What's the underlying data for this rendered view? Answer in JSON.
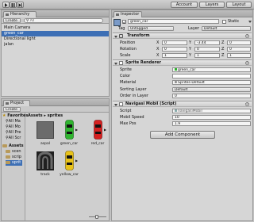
{
  "toolbar": {
    "play_icon": "play-icon",
    "pause_icon": "pause-icon",
    "step_icon": "step-icon",
    "account_label": "Account",
    "layers_label": "Layers",
    "layout_label": "Layout"
  },
  "hierarchy": {
    "tab_label": "Hierarchy",
    "create_label": "Create",
    "search_placeholder": "All",
    "items": [
      {
        "label": "Main Camera",
        "selected": false
      },
      {
        "label": "green_car",
        "selected": true
      },
      {
        "label": "Directional light",
        "selected": false
      },
      {
        "label": "jalan",
        "selected": false
      }
    ]
  },
  "project": {
    "tab_label": "Project",
    "create_label": "Create",
    "breadcrumb": "Assets ▸ sprites",
    "favorites_label": "Favorites",
    "favorites": [
      "All Ma",
      "All Mo",
      "All Pre",
      "All Scr"
    ],
    "assets_label": "Assets",
    "assets_children": [
      "scen",
      "scrip",
      "sprit"
    ],
    "sprites": [
      {
        "name": "aspal",
        "kind": "asphalt"
      },
      {
        "name": "green_car",
        "kind": "car",
        "color": "#2fb52f"
      },
      {
        "name": "red_car",
        "kind": "car",
        "color": "#d62020"
      },
      {
        "name": "track",
        "kind": "track"
      },
      {
        "name": "yellow_car",
        "kind": "car",
        "color": "#e8c21a"
      }
    ]
  },
  "inspector": {
    "tab_label": "Inspector",
    "object_name": "green_car",
    "static_label": "Static",
    "tag_label": "Tag",
    "tag_value": "Untagged",
    "layer_label": "Layer",
    "layer_value": "Default",
    "transform": {
      "title": "Transform",
      "position_label": "Position",
      "rotation_label": "Rotation",
      "scale_label": "Scale",
      "position": {
        "x": "0",
        "y": "-3.44",
        "z": "0"
      },
      "rotation": {
        "x": "0",
        "y": "0",
        "z": "0"
      },
      "scale": {
        "x": "1",
        "y": "1",
        "z": "1"
      }
    },
    "sprite_renderer": {
      "title": "Sprite Renderer",
      "sprite_label": "Sprite",
      "sprite_value": "green_car",
      "color_label": "Color",
      "color_value": "#ffffff",
      "material_label": "Material",
      "material_value": "Sprites-Default",
      "sorting_layer_label": "Sorting Layer",
      "sorting_layer_value": "Default",
      "order_label": "Order in Layer",
      "order_value": "0"
    },
    "script_component": {
      "title": "Navigasi Mobil (Script)",
      "script_label": "Script",
      "script_value": "navigasiMobil",
      "speed_label": "Mobil Speed",
      "speed_value": "10",
      "maxpos_label": "Max Pos",
      "maxpos_value": "1.9"
    },
    "add_component_label": "Add Component"
  },
  "colors": {
    "selection": "#3d6fb5",
    "panel_bg": "#d6d6d6"
  }
}
